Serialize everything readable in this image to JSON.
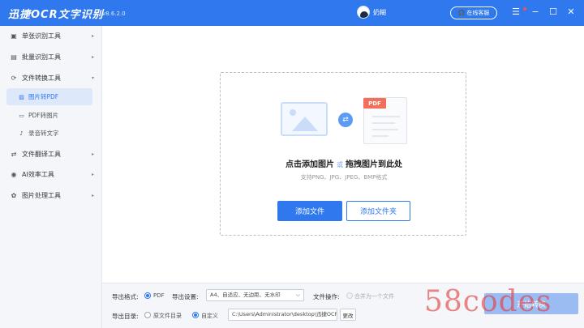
{
  "titlebar": {
    "app_title": "迅捷OCR文字识别",
    "version": "v8.6.2.0",
    "username": "奶糊",
    "service_label": "在线客服",
    "service_icon": "headset-icon",
    "menu_icon": "hamburger-menu-icon",
    "minimize": "−",
    "maximize": "☐",
    "close": "✕",
    "accent_color": "#2f78ee"
  },
  "sidebar": {
    "items": [
      {
        "label": "单张识别工具",
        "icon": "single-image-icon",
        "arrow": "▸"
      },
      {
        "label": "批量识别工具",
        "icon": "batch-icon",
        "arrow": "▸"
      },
      {
        "label": "文件转换工具",
        "icon": "file-convert-icon",
        "arrow": "▾"
      },
      {
        "label": "文件翻译工具",
        "icon": "translate-icon",
        "arrow": "▸"
      },
      {
        "label": "AI效率工具",
        "icon": "ai-icon",
        "arrow": "▸"
      },
      {
        "label": "图片处理工具",
        "icon": "image-process-icon",
        "arrow": "▸"
      }
    ],
    "sub_items": [
      {
        "label": "图片转PDF",
        "icon": "image-to-pdf-icon",
        "active": true
      },
      {
        "label": "PDF转图片",
        "icon": "pdf-to-image-icon",
        "active": false
      },
      {
        "label": "录音转文字",
        "icon": "audio-to-text-icon",
        "active": false
      }
    ]
  },
  "dropzone": {
    "title_part1": "点击添加图片",
    "or": "或",
    "title_part2": "拖拽图片到此处",
    "formats": "支持PNG、JPG、JPEG、BMP格式",
    "pdf_tag": "PDF",
    "add_file": "添加文件",
    "add_folder": "添加文件夹"
  },
  "settings": {
    "export_format_label": "导出格式:",
    "export_format_value": "PDF",
    "export_settings_label": "导出设置:",
    "export_settings_value": "A4、自适应、无边距、无水印",
    "file_operation_label": "文件操作:",
    "merge_label": "合并为一个文件",
    "export_dir_label": "导出目录:",
    "original_dir": "原文件目录",
    "custom": "自定义",
    "path": "C:\\Users\\Administrator\\desktop\\迅捷OCR文",
    "change": "更改",
    "convert_button": "开始转换"
  },
  "watermark": "58codes"
}
